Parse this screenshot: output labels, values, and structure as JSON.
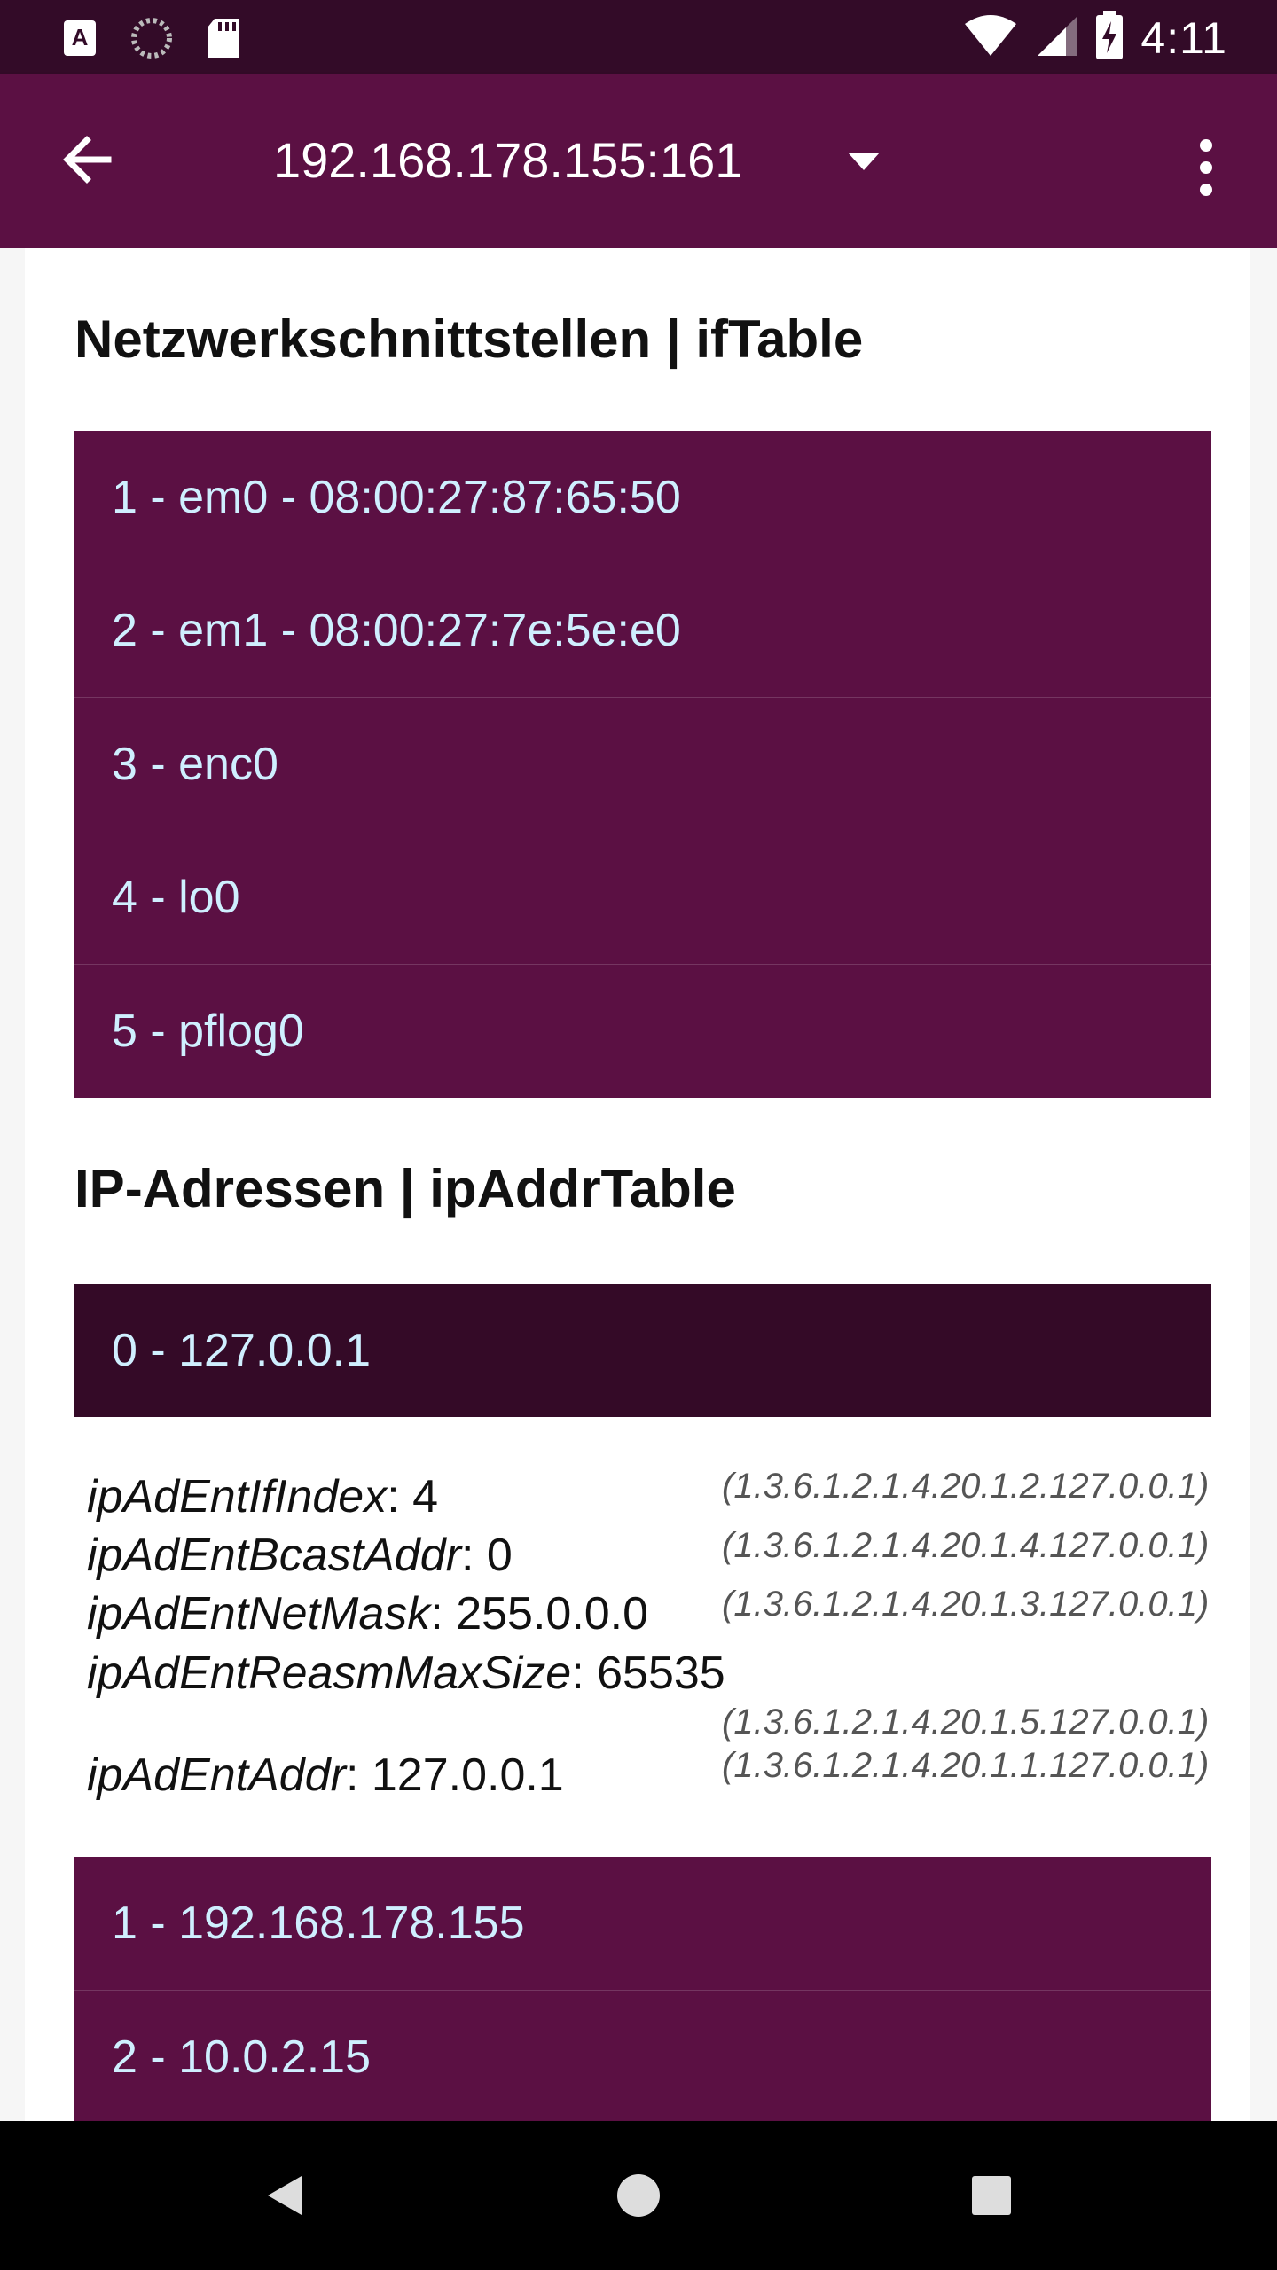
{
  "status_bar": {
    "time": "4:11",
    "icons": [
      "text-a-icon",
      "loading-icon",
      "sd-card-icon",
      "wifi-icon",
      "signal-icon",
      "battery-charging-icon"
    ]
  },
  "app_bar": {
    "title": "192.168.178.155:161",
    "icons": [
      "back-arrow-icon",
      "dropdown-arrow-icon",
      "overflow-menu-icon"
    ]
  },
  "if_section": {
    "title": "Netzwerkschnittstellen | ifTable",
    "items": [
      "1 - em0 - 08:00:27:87:65:50",
      "2 - em1 - 08:00:27:7e:5e:e0",
      "3 - enc0",
      "4 - lo0",
      "5 - pflog0"
    ]
  },
  "ip_section": {
    "title": "IP-Adressen | ipAddrTable",
    "selected": "0 - 127.0.0.1",
    "details": [
      {
        "key": "ipAdEntIfIndex",
        "value": ": 4",
        "oid": "(1.3.6.1.2.1.4.20.1.2.127.0.0.1)"
      },
      {
        "key": "ipAdEntBcastAddr",
        "value": ": 0",
        "oid": "(1.3.6.1.2.1.4.20.1.4.127.0.0.1)"
      },
      {
        "key": "ipAdEntNetMask",
        "value": ": 255.0.0.0",
        "oid": "(1.3.6.1.2.1.4.20.1.3.127.0.0.1)"
      },
      {
        "key": "ipAdEntReasmMaxSize",
        "value": ": 65535",
        "oid": "(1.3.6.1.2.1.4.20.1.5.127.0.0.1)"
      },
      {
        "key": "ipAdEntAddr",
        "value": ": 127.0.0.1",
        "oid": "(1.3.6.1.2.1.4.20.1.1.127.0.0.1)"
      }
    ],
    "items": [
      "1 - 192.168.178.155",
      "2 - 10.0.2.15"
    ]
  },
  "nav_bar": {
    "icons": [
      "back-triangle-icon",
      "home-circle-icon",
      "recents-square-icon"
    ]
  },
  "colors": {
    "primary": "#5b1043",
    "primary_dark": "#330b28",
    "selected_row": "#340a27",
    "list_text": "#cfefff"
  }
}
